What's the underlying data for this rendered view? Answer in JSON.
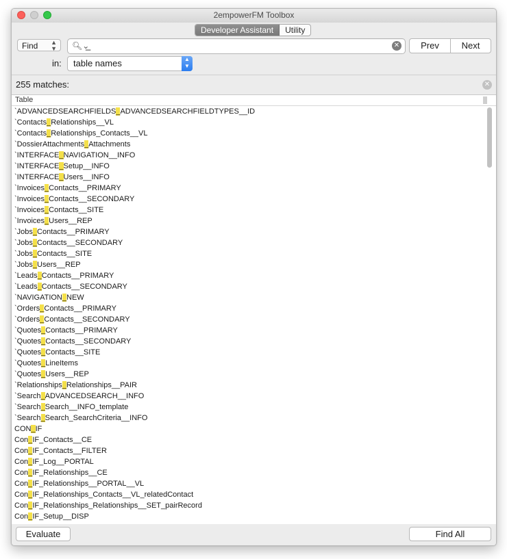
{
  "window": {
    "title": "2empowerFM Toolbox"
  },
  "tabs": [
    "Developer Assistant",
    "Utility"
  ],
  "find_mode": "Find",
  "search": {
    "value": "_"
  },
  "buttons": {
    "prev": "Prev",
    "next": "Next",
    "evaluate": "Evaluate",
    "find_all": "Find All"
  },
  "in_label": "in:",
  "scope": "table names",
  "matches": "255 matches:",
  "column_header": "Table",
  "highlight_color": "#f4e04a",
  "rows": [
    [
      "`ADVANCEDSEARCHFIELDS",
      "ADVANCEDSEARCHFIELDTYPES__ID"
    ],
    [
      "`Contacts",
      "Relationships__VL"
    ],
    [
      "`Contacts",
      "Relationships_Contacts__VL"
    ],
    [
      "`DossierAttachments",
      "Attachments"
    ],
    [
      "`INTERFACE",
      "NAVIGATION__INFO"
    ],
    [
      "`INTERFACE",
      "Setup__INFO"
    ],
    [
      "`INTERFACE",
      "Users__INFO"
    ],
    [
      "`Invoices",
      "Contacts__PRIMARY"
    ],
    [
      "`Invoices",
      "Contacts__SECONDARY"
    ],
    [
      "`Invoices",
      "Contacts__SITE"
    ],
    [
      "`Invoices",
      "Users__REP"
    ],
    [
      "`Jobs",
      "Contacts__PRIMARY"
    ],
    [
      "`Jobs",
      "Contacts__SECONDARY"
    ],
    [
      "`Jobs",
      "Contacts__SITE"
    ],
    [
      "`Jobs",
      "Users__REP"
    ],
    [
      "`Leads",
      "Contacts__PRIMARY"
    ],
    [
      "`Leads",
      "Contacts__SECONDARY"
    ],
    [
      "`NAVIGATION",
      "NEW"
    ],
    [
      "`Orders",
      "Contacts__PRIMARY"
    ],
    [
      "`Orders",
      "Contacts__SECONDARY"
    ],
    [
      "`Quotes",
      "Contacts__PRIMARY"
    ],
    [
      "`Quotes",
      "Contacts__SECONDARY"
    ],
    [
      "`Quotes",
      "Contacts__SITE"
    ],
    [
      "`Quotes",
      "LineItems"
    ],
    [
      "`Quotes",
      "Users__REP"
    ],
    [
      "`Relationships",
      "Relationships__PAIR"
    ],
    [
      "`Search",
      "ADVANCEDSEARCH__INFO"
    ],
    [
      "`Search",
      "Search__INFO_template"
    ],
    [
      "`Search",
      "Search_SearchCriteria__INFO"
    ],
    [
      "CON",
      "IF"
    ],
    [
      "Con",
      "IF_Contacts__CE"
    ],
    [
      "Con",
      "IF_Contacts__FILTER"
    ],
    [
      "Con",
      "IF_Log__PORTAL"
    ],
    [
      "Con",
      "IF_Relationships__CE"
    ],
    [
      "Con",
      "IF_Relationships__PORTAL__VL"
    ],
    [
      "Con",
      "IF_Relationships_Contacts__VL_relatedContact"
    ],
    [
      "Con",
      "IF_Relationships_Relationships__SET_pairRecord"
    ],
    [
      "Con",
      "IF_Setup__DISP"
    ]
  ]
}
